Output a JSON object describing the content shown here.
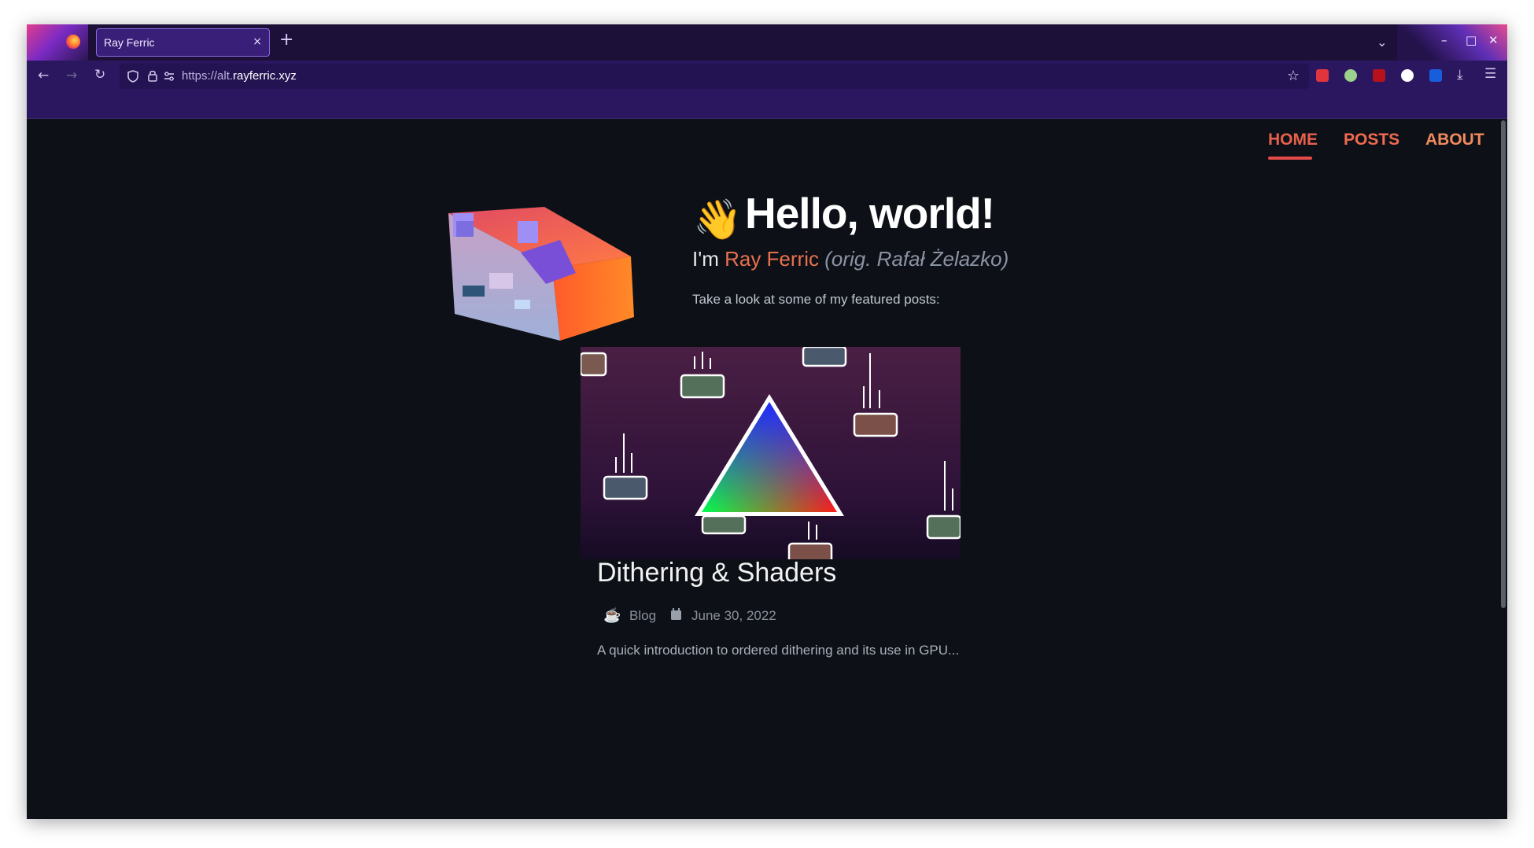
{
  "browser": {
    "tab_title": "Ray Ferric",
    "tab_close": "×",
    "new_tab": "+",
    "url_prefix": "https://alt.",
    "url_host": "rayferric.xyz"
  },
  "site": {
    "nav": {
      "home": "HOME",
      "posts": "POSTS",
      "about": "ABOUT"
    },
    "hero": {
      "wave_emoji": "👋",
      "greeting": "Hello, world!",
      "intro_prefix": "I'm ",
      "name": "Ray Ferric",
      "orig_name": "(orig. Rafał Żelazko)",
      "featured_text": "Take a look at some of my featured posts:"
    },
    "post": {
      "title": "Dithering & Shaders",
      "category": "Blog",
      "date": "June 30, 2022",
      "excerpt": "A quick introduction to ordered dithering and its use in GPU..."
    }
  },
  "colors": {
    "accent": "#e8704f",
    "background": "#0d1117",
    "chrome": "#2a1760"
  }
}
